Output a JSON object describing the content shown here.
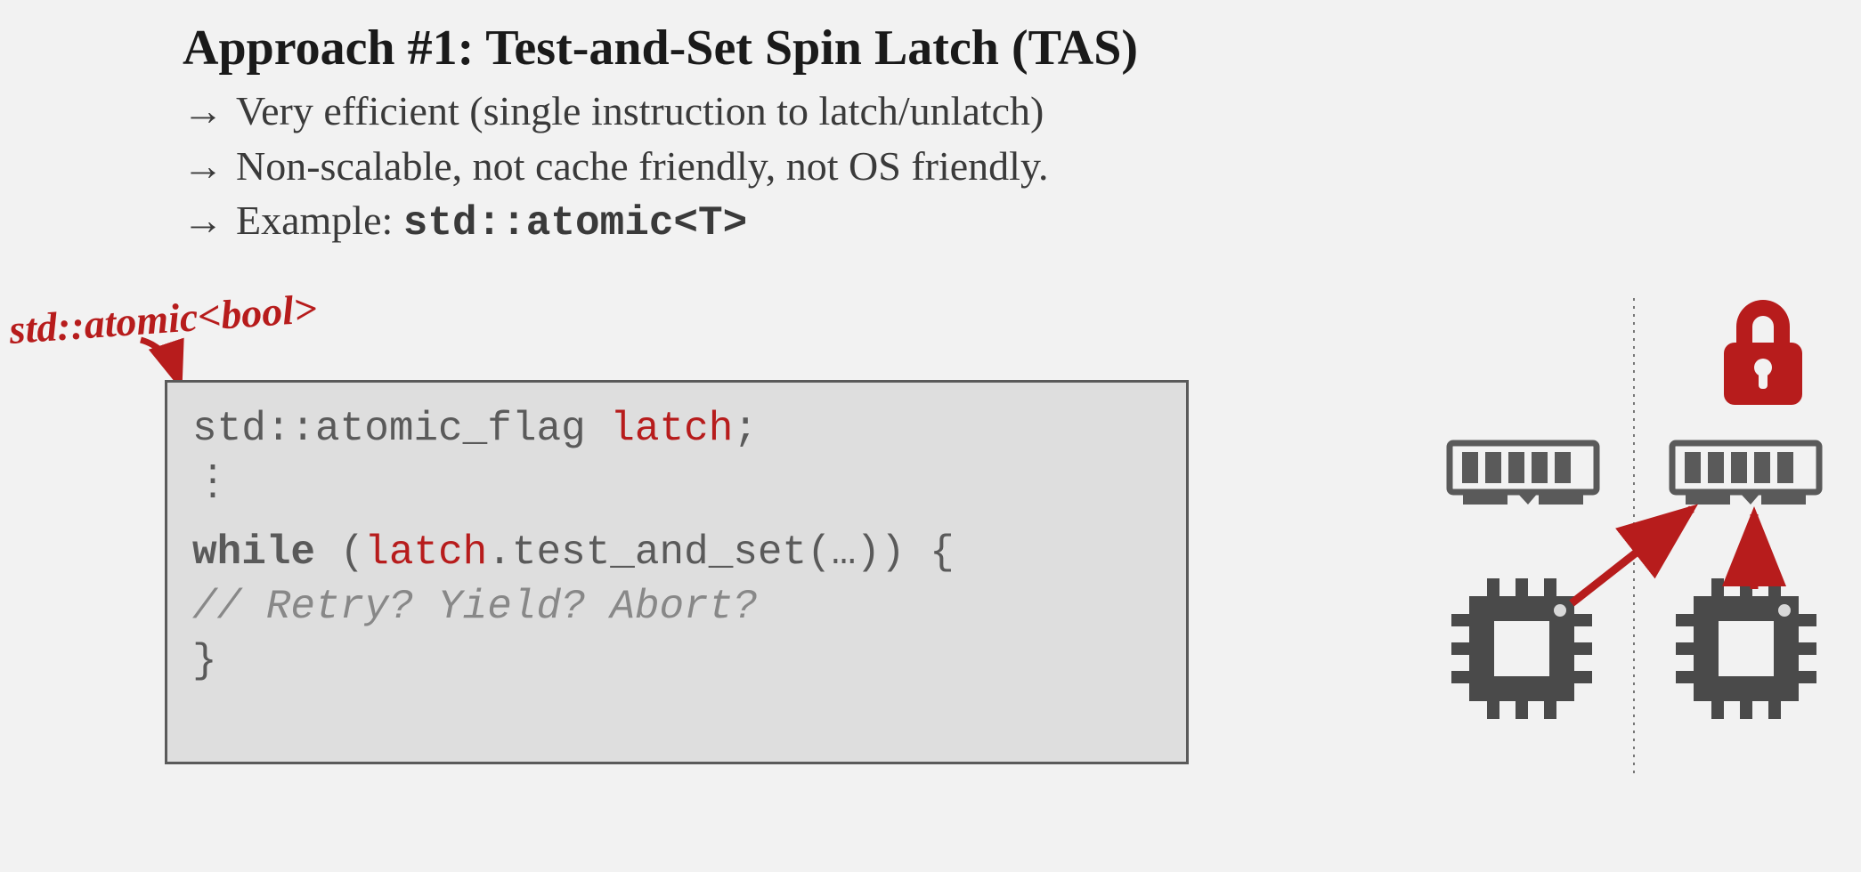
{
  "heading": "Approach #1: Test-and-Set Spin Latch (TAS)",
  "bullets": {
    "arrow": "→",
    "items": [
      "Very efficient (single instruction to latch/unlatch)",
      "Non-scalable, not cache friendly, not OS friendly."
    ],
    "example_prefix": "Example: ",
    "example_code": "std::atomic<T>"
  },
  "annotation": "std::atomic<bool>",
  "code": {
    "line1_type": "std::atomic_flag ",
    "line1_var": "latch",
    "line1_end": ";",
    "line2_vdots": "⋮",
    "line3_while": "while",
    "line3_open": " (",
    "line3_var": "latch",
    "line3_rest": ".test_and_set(…)) {",
    "line4_comment": "   // Retry? Yield? Abort?",
    "line5_close": "}"
  },
  "colors": {
    "accent": "#b71c1c",
    "text": "#3a3a3a",
    "codebox_bg": "#dedede",
    "codebox_border": "#5a5a5a",
    "icon_dark": "#4a4a4a"
  }
}
